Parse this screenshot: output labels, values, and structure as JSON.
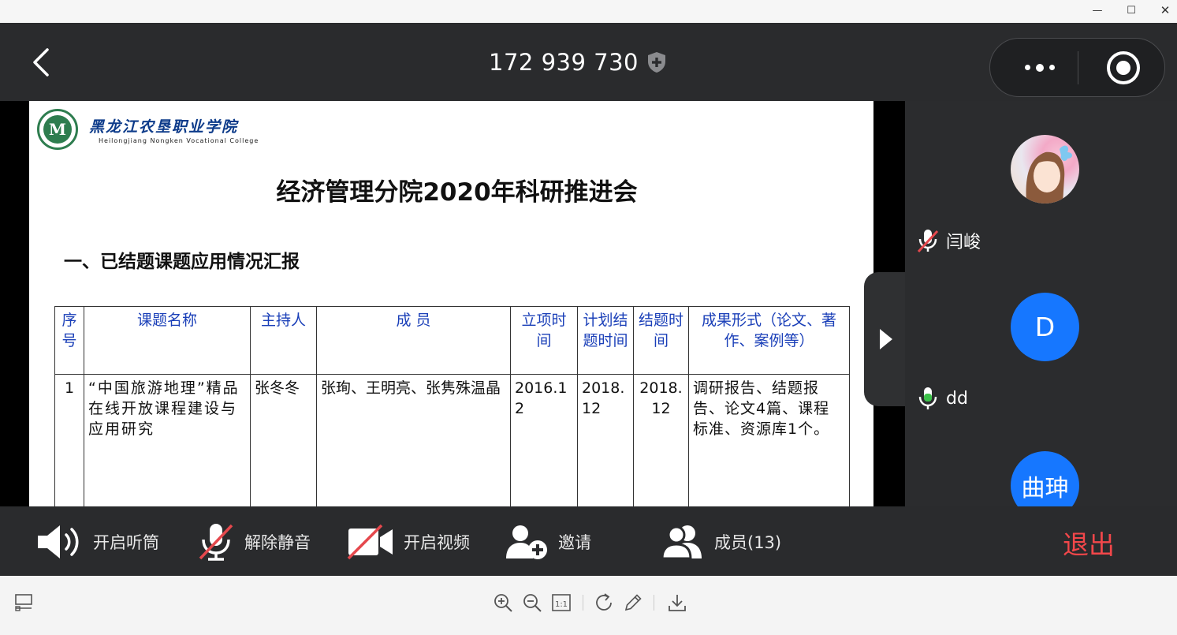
{
  "window": {
    "minimize": "—",
    "maximize": "☐",
    "close": "✕"
  },
  "meeting": {
    "id": "172 939 730"
  },
  "slide": {
    "logo_text": "M",
    "school_cn": "黑龙江农垦职业学院",
    "school_en": "Heilongjiang Nongken Vocational College",
    "title": "经济管理分院2020年科研推进会",
    "section": "一、已结题课题应用情况汇报",
    "table": {
      "headers": [
        "序号",
        "课题名称",
        "主持人",
        "成 员",
        "立项时间",
        "计划结题时间",
        "结题时间",
        "成果形式（论文、著作、案例等）"
      ],
      "rows": [
        [
          "1",
          "“中国旅游地理”精品在线开放课程建设与应用研究",
          "张冬冬",
          "张珣、王明亮、张隽殊温晶",
          "2016.12",
          "2018.12",
          "2018.12",
          "调研报告、结题报告、论文4篇、课程标准、资源库1个。"
        ]
      ]
    }
  },
  "participants": [
    {
      "name": "闫峻",
      "avatar_type": "photo",
      "mic": "muted"
    },
    {
      "name": "dd",
      "avatar_text": "D",
      "avatar_color": "#1677ff",
      "mic": "active"
    },
    {
      "name": "曲珅",
      "avatar_text": "曲珅",
      "avatar_color": "#1677ff"
    }
  ],
  "controls": {
    "speaker": "开启听筒",
    "unmute": "解除静音",
    "video": "开启视频",
    "invite": "邀请",
    "members": "成员(13)",
    "exit": "退出"
  },
  "colors": {
    "accent": "#1677ff",
    "exit": "#f2474a",
    "table_header": "#1a3fb8",
    "background_dark": "#2a2b2d",
    "mic_active": "#3cc24a",
    "mic_muted": "#e5484d"
  },
  "icons": [
    "back-chevron-icon",
    "shield-plus-icon",
    "more-dots-icon",
    "record-icon",
    "speaker-icon",
    "mic-muted-icon",
    "video-off-icon",
    "invite-user-icon",
    "members-icon",
    "thumbnail-icon",
    "zoom-in-icon",
    "zoom-out-icon",
    "actual-size-icon",
    "rotate-icon",
    "edit-icon",
    "download-icon"
  ]
}
